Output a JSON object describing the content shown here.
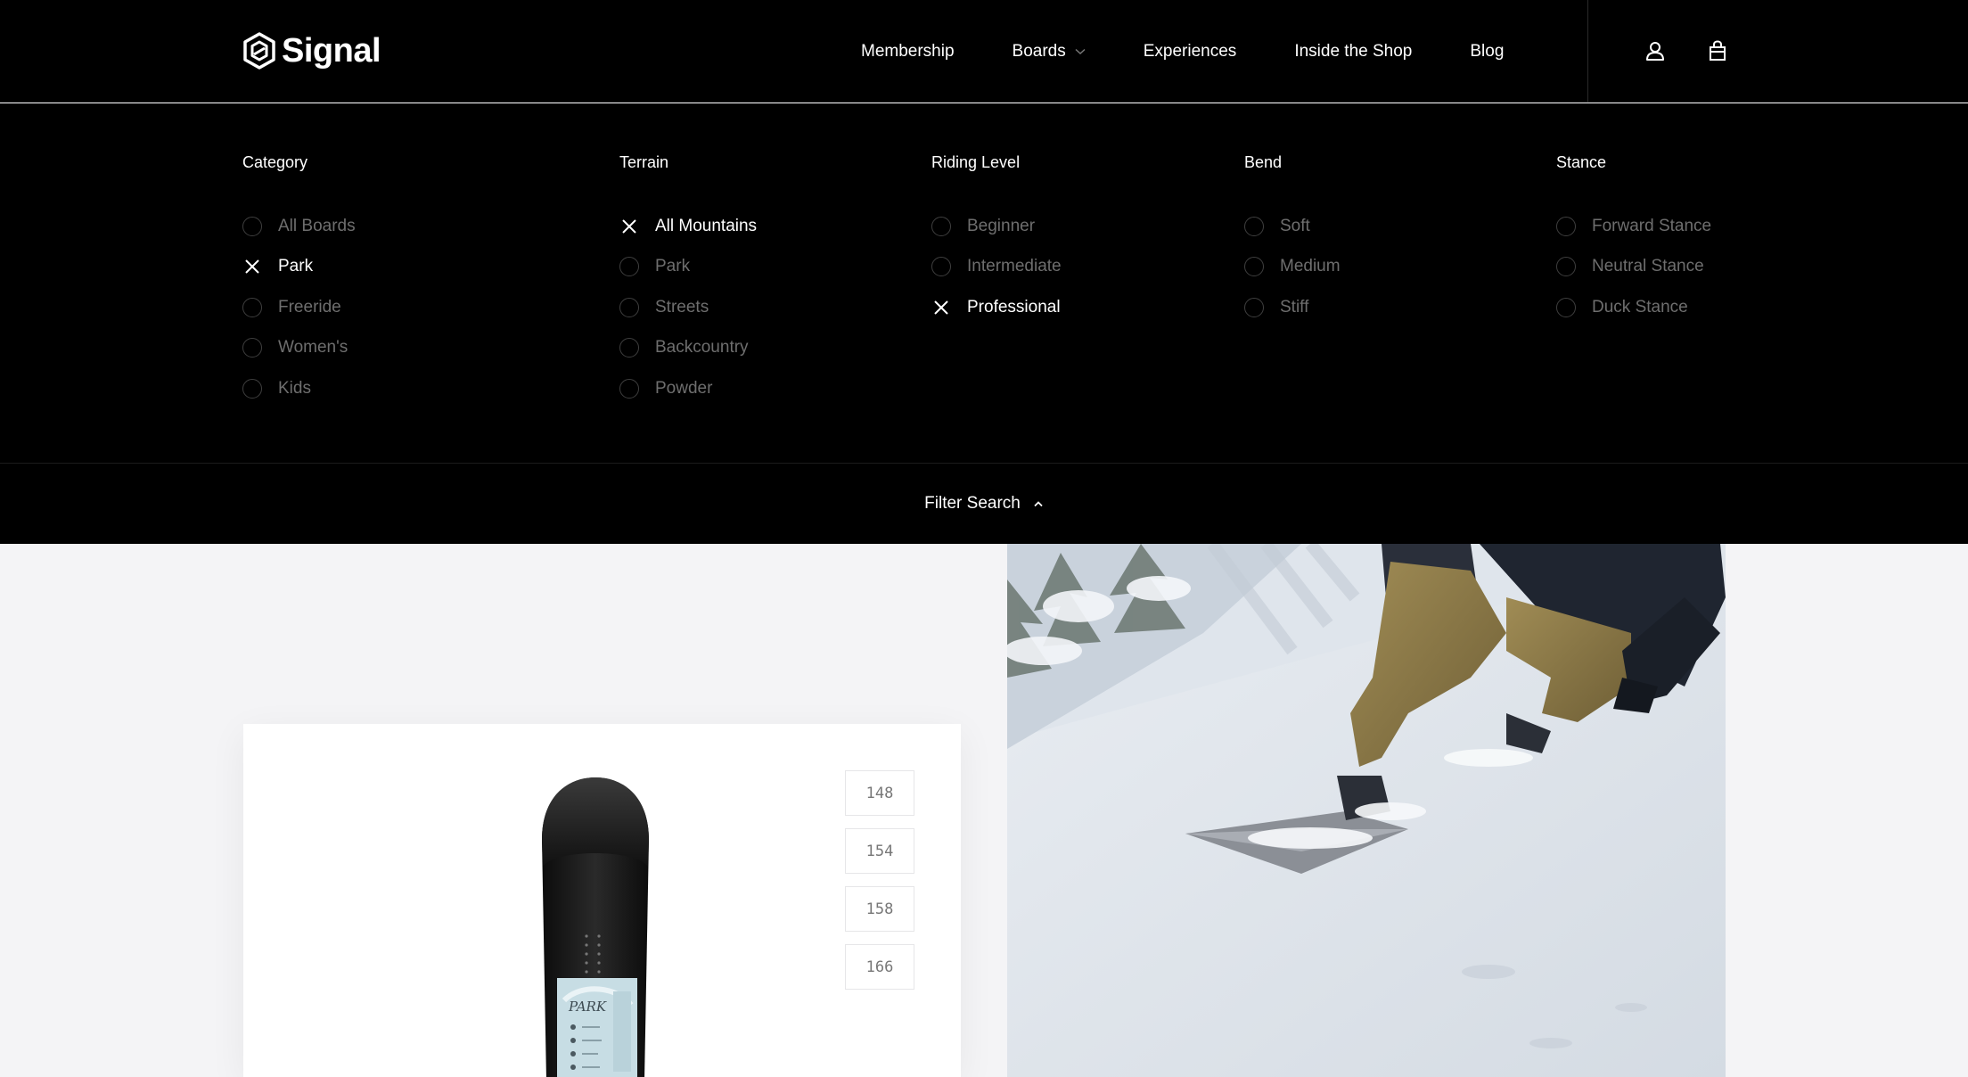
{
  "brand": {
    "name": "Signal"
  },
  "nav": {
    "items": [
      {
        "label": "Membership"
      },
      {
        "label": "Boards"
      },
      {
        "label": "Experiences"
      },
      {
        "label": "Inside the Shop"
      },
      {
        "label": "Blog"
      }
    ]
  },
  "filters": {
    "columns": [
      {
        "title": "Category",
        "options": [
          {
            "label": "All Boards",
            "checked": false
          },
          {
            "label": "Park",
            "checked": true
          },
          {
            "label": "Freeride",
            "checked": false
          },
          {
            "label": "Women's",
            "checked": false
          },
          {
            "label": "Kids",
            "checked": false
          }
        ]
      },
      {
        "title": "Terrain",
        "options": [
          {
            "label": "All Mountains",
            "checked": true
          },
          {
            "label": "Park",
            "checked": false
          },
          {
            "label": "Streets",
            "checked": false
          },
          {
            "label": "Backcountry",
            "checked": false
          },
          {
            "label": "Powder",
            "checked": false
          }
        ]
      },
      {
        "title": "Riding Level",
        "options": [
          {
            "label": "Beginner",
            "checked": false
          },
          {
            "label": "Intermediate",
            "checked": false
          },
          {
            "label": "Professional",
            "checked": true
          }
        ]
      },
      {
        "title": "Bend",
        "options": [
          {
            "label": "Soft",
            "checked": false
          },
          {
            "label": "Medium",
            "checked": false
          },
          {
            "label": "Stiff",
            "checked": false
          }
        ]
      },
      {
        "title": "Stance",
        "options": [
          {
            "label": "Forward Stance",
            "checked": false
          },
          {
            "label": "Neutral Stance",
            "checked": false
          },
          {
            "label": "Duck Stance",
            "checked": false
          }
        ]
      }
    ],
    "toggle_label": "Filter Search"
  },
  "product": {
    "sizes": [
      "148",
      "154",
      "158",
      "166"
    ],
    "board_graphic_text": "PARK"
  },
  "colors": {
    "header_bg": "#000000",
    "page_bg": "#f4f4f6",
    "text_muted": "#6e6e6e"
  }
}
